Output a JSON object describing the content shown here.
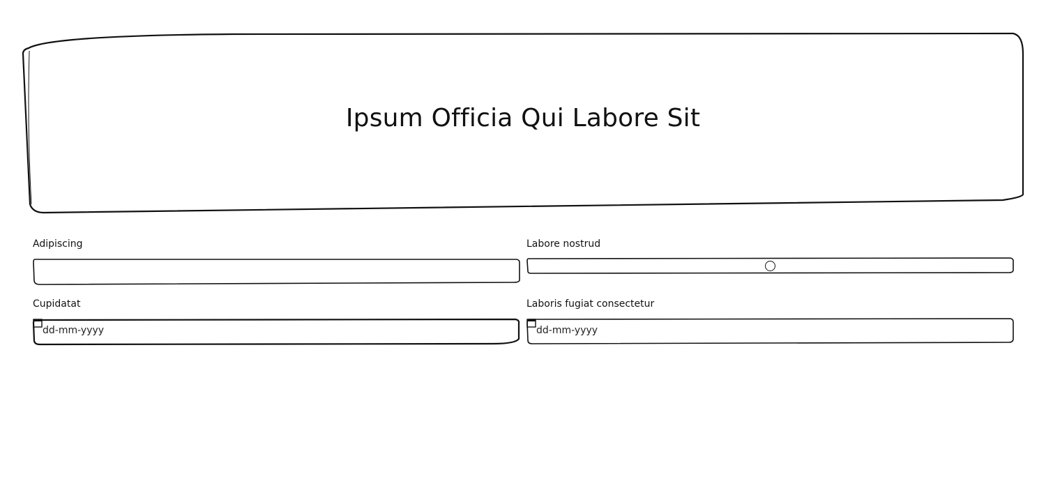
{
  "hero": {
    "title": "Ipsum Officia Qui Labore Sit"
  },
  "fields": {
    "adipiscing": {
      "label": "Adipiscing",
      "value": ""
    },
    "labore_nostrud": {
      "label": "Labore nostrud",
      "value_fraction": 0.5
    },
    "cupidatat": {
      "label": "Cupidatat",
      "placeholder": "dd-mm-yyyy"
    },
    "laboris": {
      "label": "Laboris fugiat consectetur",
      "placeholder": "dd-mm-yyyy"
    }
  },
  "colors": {
    "stroke": "#111111",
    "background": "#ffffff"
  },
  "icons": {
    "date_picker": "calendar-icon"
  }
}
